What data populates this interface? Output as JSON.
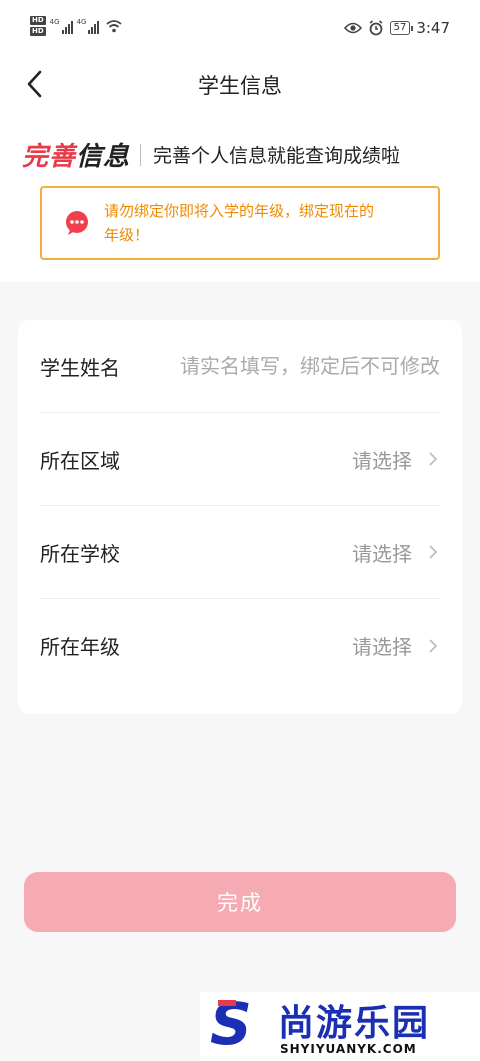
{
  "status_bar": {
    "hd1": "HD",
    "hd2": "HD",
    "net1": "4G",
    "net2": "4G",
    "battery": "57",
    "time": "3:47"
  },
  "nav": {
    "title": "学生信息"
  },
  "intro": {
    "brand_part1": "完善",
    "brand_part2": "信息",
    "subtitle": "完善个人信息就能查询成绩啦"
  },
  "notice": {
    "line1": "请勿绑定你即将入学的年级，绑定现在的",
    "line2": "年级！"
  },
  "form": {
    "name_label": "学生姓名",
    "name_placeholder": "请实名填写，绑定后不可修改",
    "region_label": "所在区域",
    "region_value": "请选择",
    "school_label": "所在学校",
    "school_value": "请选择",
    "grade_label": "所在年级",
    "grade_value": "请选择"
  },
  "actions": {
    "done_label": "完成"
  },
  "watermark": {
    "logo": "S",
    "name": "尚游乐园",
    "domain": "SHYIYUANYK.COM"
  },
  "colors": {
    "brand_red": "#e83a4a",
    "notice_border": "#f0b03a",
    "notice_text": "#f08a00",
    "button_disabled": "#f6aab2",
    "watermark_blue": "#1a2fb3"
  }
}
